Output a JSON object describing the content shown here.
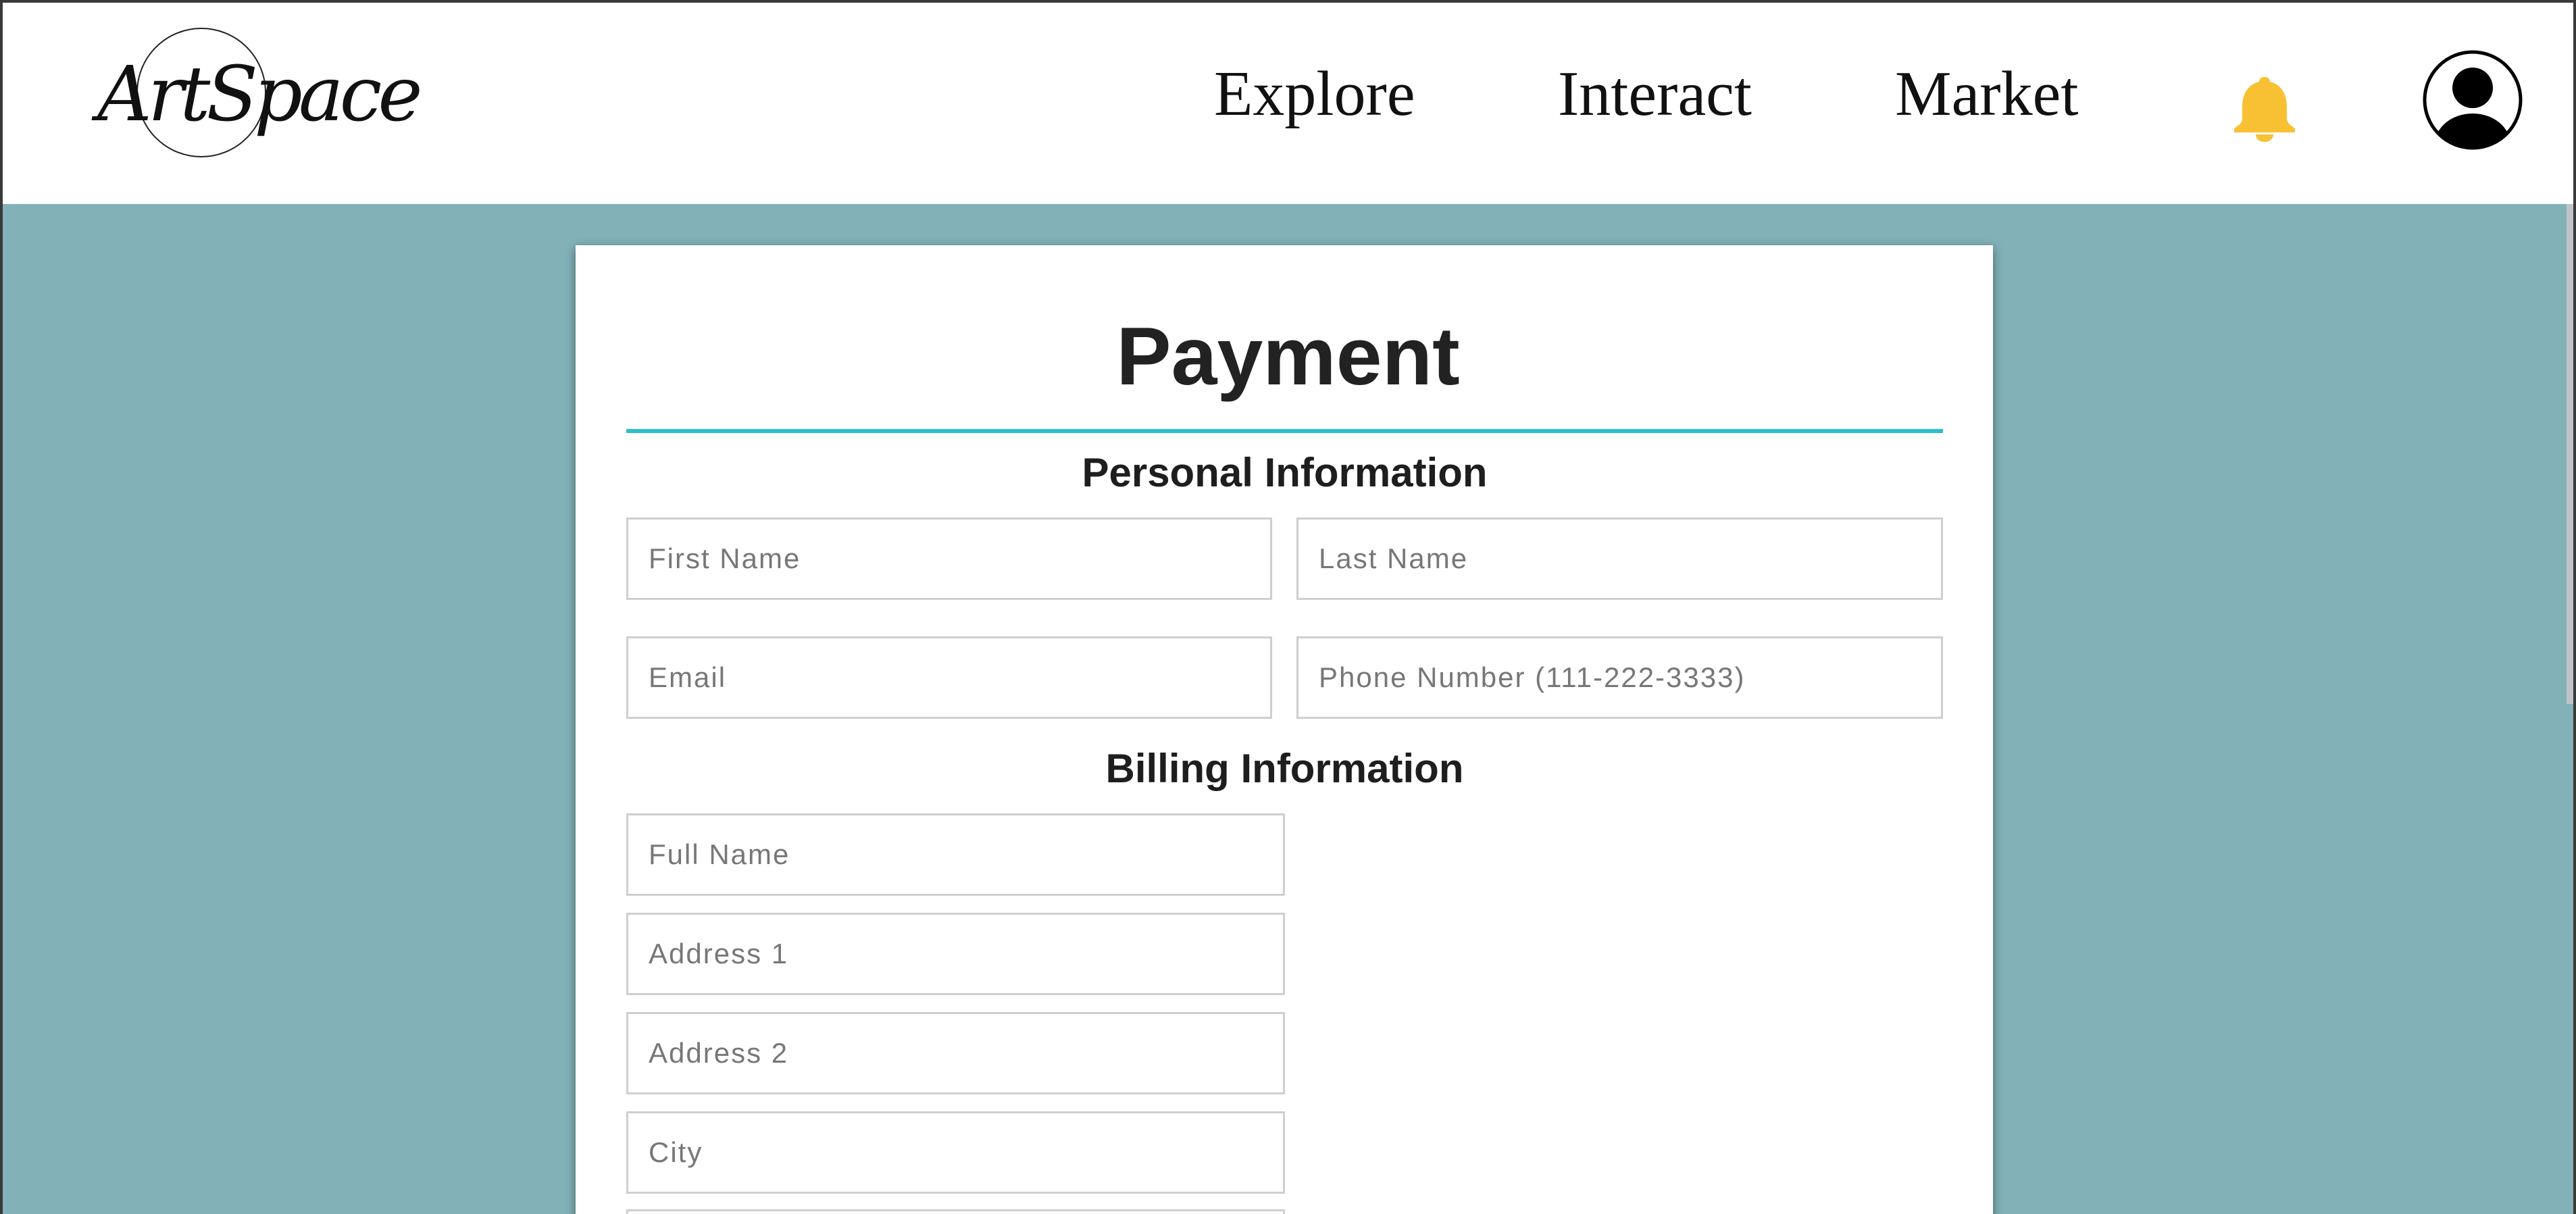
{
  "nav": {
    "logo_text": "ArtSpace",
    "links": [
      "Explore",
      "Interact",
      "Market"
    ]
  },
  "icons": {
    "notifications": "bell-icon",
    "profile": "user-avatar-icon"
  },
  "colors": {
    "page_background": "#82b2b8",
    "accent_rule": "#2ac0cc",
    "bell": "#f8c033"
  },
  "payment": {
    "title": "Payment",
    "personal": {
      "heading": "Personal Information",
      "first_name_placeholder": "First Name",
      "last_name_placeholder": "Last Name",
      "email_placeholder": "Email",
      "phone_placeholder": "Phone Number (111-222-3333)"
    },
    "billing": {
      "heading": "Billing Information",
      "full_name_placeholder": "Full Name",
      "address1_placeholder": "Address 1",
      "address2_placeholder": "Address 2",
      "city_placeholder": "City"
    }
  }
}
